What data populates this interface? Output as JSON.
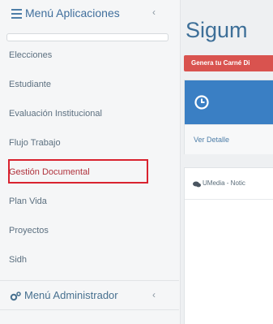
{
  "sidebar": {
    "header": {
      "title": "Menú Aplicaciones",
      "chevron": "‹",
      "icon": "list-icon"
    },
    "items": [
      {
        "label": "Elecciones"
      },
      {
        "label": "Estudiante"
      },
      {
        "label": "Evaluación Institucional"
      },
      {
        "label": "Flujo Trabajo"
      },
      {
        "label": "Gestión Documental",
        "highlighted": true
      },
      {
        "label": "Plan Vida"
      },
      {
        "label": "Proyectos"
      },
      {
        "label": "Sidh"
      }
    ],
    "admin": {
      "title": "Menú Administrador",
      "chevron": "‹",
      "icon": "gears-icon"
    }
  },
  "main": {
    "title": "Sigum",
    "carne_button": "Genera tu Carné Di",
    "panel": {
      "icon": "clock-icon",
      "link": "Ver Detalle",
      "header_color": "#3a7fc4"
    },
    "news": {
      "icon": "comments-icon",
      "label": "UMedia - Notic"
    }
  },
  "colors": {
    "accent": "#3a7fc4",
    "danger": "#d9534f",
    "highlight_border": "#d9232f"
  }
}
